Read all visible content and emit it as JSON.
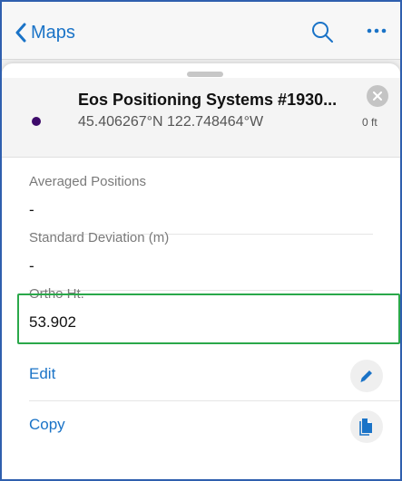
{
  "nav": {
    "back_label": "Maps",
    "back_icon": "chevron-left-icon",
    "search_icon": "search-icon",
    "more_icon": "more-icon"
  },
  "feature": {
    "title": "Eos Positioning Systems #1930...",
    "coordinates": "45.406267°N  122.748464°W",
    "distance": "0 ft",
    "marker_color": "#3d0a6a"
  },
  "fields": [
    {
      "label": "Averaged Positions",
      "value": "-"
    },
    {
      "label": "Standard Deviation (m)",
      "value": "-"
    },
    {
      "label": "Ortho Ht.",
      "value": "53.902"
    }
  ],
  "actions": [
    {
      "label": "Edit",
      "icon": "pencil-icon"
    },
    {
      "label": "Copy",
      "icon": "copy-icon"
    }
  ],
  "colors": {
    "accent": "#1a73c7",
    "highlight": "#2aa84a",
    "frame": "#2f5fae"
  }
}
